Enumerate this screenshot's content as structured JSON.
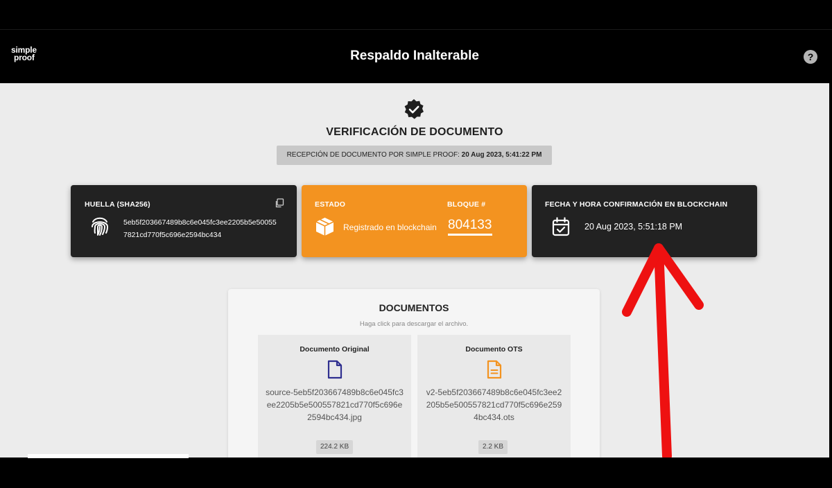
{
  "header": {
    "logo_line1": "simple",
    "logo_line2": "proof",
    "title": "Respaldo Inalterable",
    "help_label": "?"
  },
  "verification": {
    "icon": "verified-badge-icon",
    "title": "VERIFICACIÓN DE DOCUMENTO",
    "reception_label": "RECEPCIÓN DE DOCUMENTO POR SIMPLE PROOF:",
    "reception_date": "20 Aug 2023, 5:41:22 PM"
  },
  "cards": {
    "hash": {
      "label": "HUELLA (SHA256)",
      "value": "5eb5f203667489b8c6e045fc3ee2205b5e500557821cd770f5c696e2594bc434",
      "icon": "fingerprint-icon",
      "copy_icon": "copy-icon"
    },
    "status": {
      "label": "ESTADO",
      "value": "Registrado en blockchain",
      "icon": "cube-icon",
      "block_label": "BLOQUE #",
      "block_number": "804133"
    },
    "confirmation": {
      "label": "FECHA Y HORA CONFIRMACIÓN EN BLOCKCHAIN",
      "value": "20 Aug 2023, 5:51:18 PM",
      "icon": "calendar-check-icon"
    }
  },
  "documents": {
    "title": "DOCUMENTOS",
    "hint": "Haga click para descargar el archivo.",
    "items": [
      {
        "name": "Documento Original",
        "file": "source-5eb5f203667489b8c6e045fc3ee2205b5e500557821cd770f5c696e2594bc434.jpg",
        "size": "224.2 KB",
        "icon": "file-icon",
        "icon_color": "#2f2f8f"
      },
      {
        "name": "Documento OTS",
        "file": "v2-5eb5f203667489b8c6e045fc3ee2205b5e500557821cd770f5c696e2594bc434.ots",
        "size": "2.2 KB",
        "icon": "file-text-icon",
        "icon_color": "#f39320"
      }
    ]
  },
  "colors": {
    "accent": "#f39320",
    "card_dark": "#222222",
    "background": "#ececec",
    "annotation_arrow": "#ee1111"
  }
}
